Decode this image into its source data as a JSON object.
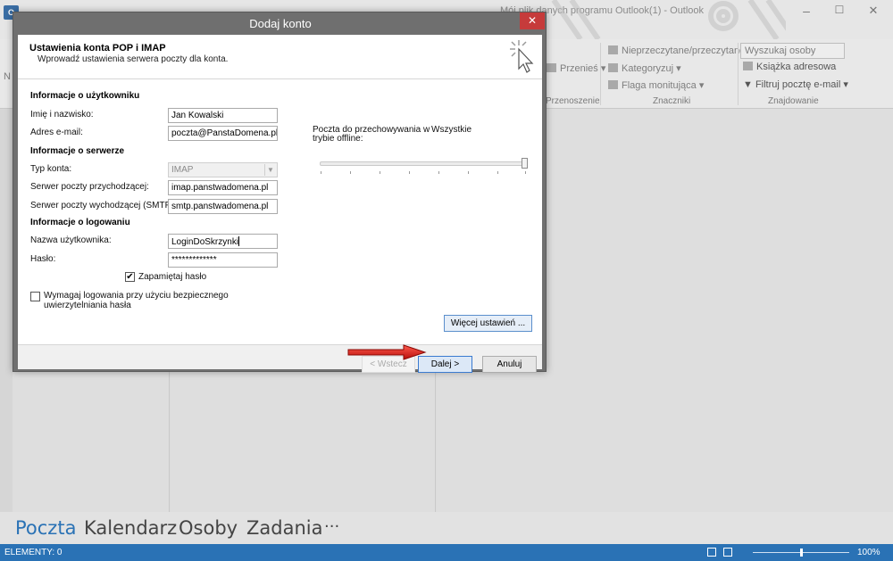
{
  "outlook": {
    "logo": "O",
    "title": "Mój plik danych programu Outlook(1) - Outlook",
    "ribbon": {
      "left_letter": "N",
      "move_label": "Przenieś",
      "move_group": "Przenoszenie",
      "unread_label": "Nieprzeczytane/przeczytane",
      "categorize_label": "Kategoryzuj",
      "flag_label": "Flaga monitująca",
      "tags_group": "Znaczniki",
      "search_people_placeholder": "Wyszukaj osoby",
      "address_book_label": "Książka adresowa",
      "filter_label": "Filtruj pocztę e-mail",
      "find_group": "Znajdowanie"
    },
    "nav": {
      "mail": "Poczta",
      "calendar": "Kalendarz",
      "people": "Osoby",
      "tasks": "Zadania",
      "more": "···"
    },
    "status": {
      "elements": "ELEMENTY: 0",
      "zoom": "100%"
    }
  },
  "dialog": {
    "title": "Dodaj konto",
    "close_glyph": "✕",
    "header_title": "Ustawienia konta POP i IMAP",
    "header_subtitle": "Wprowadź ustawienia serwera poczty dla konta.",
    "user_section": "Informacje o użytkowniku",
    "name_label": "Imię i nazwisko:",
    "name_value": "Jan Kowalski",
    "email_label": "Adres e-mail:",
    "email_value": "poczta@PanstaDomena.pl",
    "server_section": "Informacje o serwerze",
    "account_type_label": "Typ konta:",
    "account_type_value": "IMAP",
    "incoming_label": "Serwer poczty przychodzącej:",
    "incoming_value": "imap.panstwadomena.pl",
    "outgoing_label": "Serwer poczty wychodzącej (SMTP):",
    "outgoing_value": "smtp.panstwadomena.pl",
    "login_section": "Informacje o logowaniu",
    "username_label": "Nazwa użytkownika:",
    "username_value": "LoginDoSkrzynki",
    "password_label": "Hasło:",
    "password_value": "*************",
    "remember_label": "Zapamiętaj hasło",
    "remember_checked": true,
    "spa_label_line1": "Wymagaj logowania przy użyciu bezpiecznego",
    "spa_label_line2": "uwierzytelniania hasła",
    "spa_checked": false,
    "offline_label_line1": "Poczta do przechowywania w",
    "offline_label_line2": "trybie offline:",
    "offline_value": "Wszystkie",
    "offline_slider_fraction": 1.0,
    "more_settings_button": "Więcej ustawień ...",
    "back_button": "< Wstecz",
    "next_button": "Dalej >",
    "cancel_button": "Anuluj"
  },
  "colors": {
    "accent_blue": "#2a72b5",
    "close_red": "#c63b3b",
    "annotation_arrow": "#e0201b"
  }
}
